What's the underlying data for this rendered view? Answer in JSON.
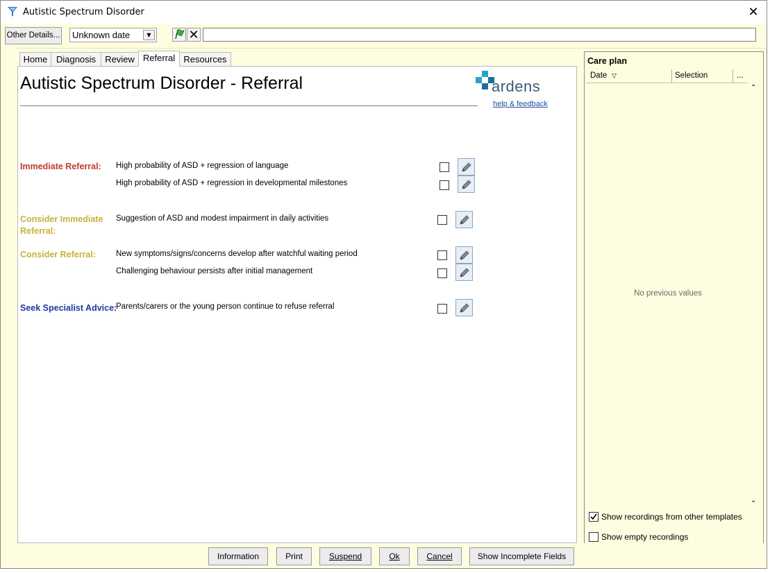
{
  "window": {
    "title": "Autistic Spectrum Disorder",
    "close_glyph": "✕"
  },
  "toolbar": {
    "other_details": "Other Details...",
    "date_value": "Unknown date",
    "text_value": ""
  },
  "tabs": [
    {
      "label": "Home"
    },
    {
      "label": "Diagnosis"
    },
    {
      "label": "Review"
    },
    {
      "label": "Referral"
    },
    {
      "label": "Resources"
    }
  ],
  "active_tab": "Referral",
  "page": {
    "title": "Autistic Spectrum Disorder - Referral",
    "logo_text": "ardens",
    "help_link": "help & feedback"
  },
  "sections": [
    {
      "label": "Immediate Referral:",
      "color": "#c0392b",
      "items": [
        {
          "text": "High probability of ASD + regression of language",
          "checked": false
        },
        {
          "text": "High probability of ASD + regression in developmental milestones",
          "checked": false
        }
      ]
    },
    {
      "label": "Consider Immediate Referral:",
      "color": "#c8b23a",
      "items": [
        {
          "text": "Suggestion of ASD and modest impairment in daily activities",
          "checked": false
        }
      ]
    },
    {
      "label": "Consider Referral:",
      "color": "#c8b23a",
      "items": [
        {
          "text": "New symptoms/signs/concerns develop after watchful waiting period",
          "checked": false
        },
        {
          "text": "Challenging behaviour persists after initial management",
          "checked": false
        }
      ]
    },
    {
      "label": "Seek Specialist Advice:",
      "color": "#1f3a9c",
      "items": [
        {
          "text": "Parents/carers or the young person continue to refuse referral",
          "checked": false
        }
      ]
    }
  ],
  "buttons": {
    "information": "Information",
    "print": "Print",
    "suspend": "Suspend",
    "ok": "Ok",
    "cancel": "Cancel",
    "show_incomplete": "Show Incomplete Fields"
  },
  "careplan": {
    "title": "Care plan",
    "col_date": "Date",
    "col_selection": "Selection",
    "col_more": "...",
    "empty_text": "No previous values",
    "show_other_templates": "Show recordings from other templates",
    "show_other_templates_checked": true,
    "show_empty": "Show empty recordings",
    "show_empty_checked": false
  },
  "icons": {
    "app": "funnel-app-icon",
    "flag": "green-flag-icon",
    "clear": "x-icon",
    "edit": "pencil-icon",
    "logo": "ardens-cross-logo"
  }
}
